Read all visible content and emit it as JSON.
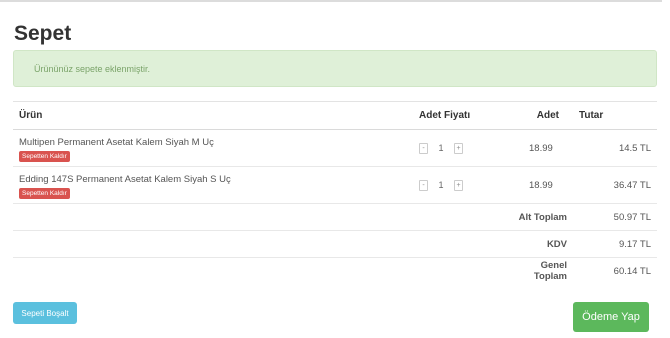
{
  "page": {
    "title": "Sepet"
  },
  "alert": {
    "message": "Ürününüz sepete eklenmiştir."
  },
  "table": {
    "headers": {
      "product": "Ürün",
      "unit_price": "Adet Fiyatı",
      "quantity": "Adet",
      "total": "Tutar"
    },
    "items": [
      {
        "name": "Multipen Permanent Asetat Kalem Siyah M Uç",
        "remove_label": "Sepetten Kaldır",
        "qty": "1",
        "minus": "-",
        "plus": "+",
        "price": "18.99",
        "total": "14.5 TL"
      },
      {
        "name": "Edding 147S Permanent Asetat Kalem Siyah S Uç",
        "remove_label": "Sepetten Kaldır",
        "qty": "1",
        "minus": "-",
        "plus": "+",
        "price": "18.99",
        "total": "36.47 TL"
      }
    ],
    "summary": [
      {
        "label": "Alt Toplam",
        "value": "50.97 TL"
      },
      {
        "label": "KDV",
        "value": "9.17 TL"
      },
      {
        "label": "Genel Toplam",
        "value": "60.14 TL"
      }
    ]
  },
  "actions": {
    "empty_cart": "Sepeti Boşalt",
    "checkout": "Ödeme Yap"
  },
  "colors": {
    "remove": "#d9534f",
    "empty": "#5bc0de",
    "checkout": "#5cb85c",
    "alert_bg": "#dff0d8"
  }
}
